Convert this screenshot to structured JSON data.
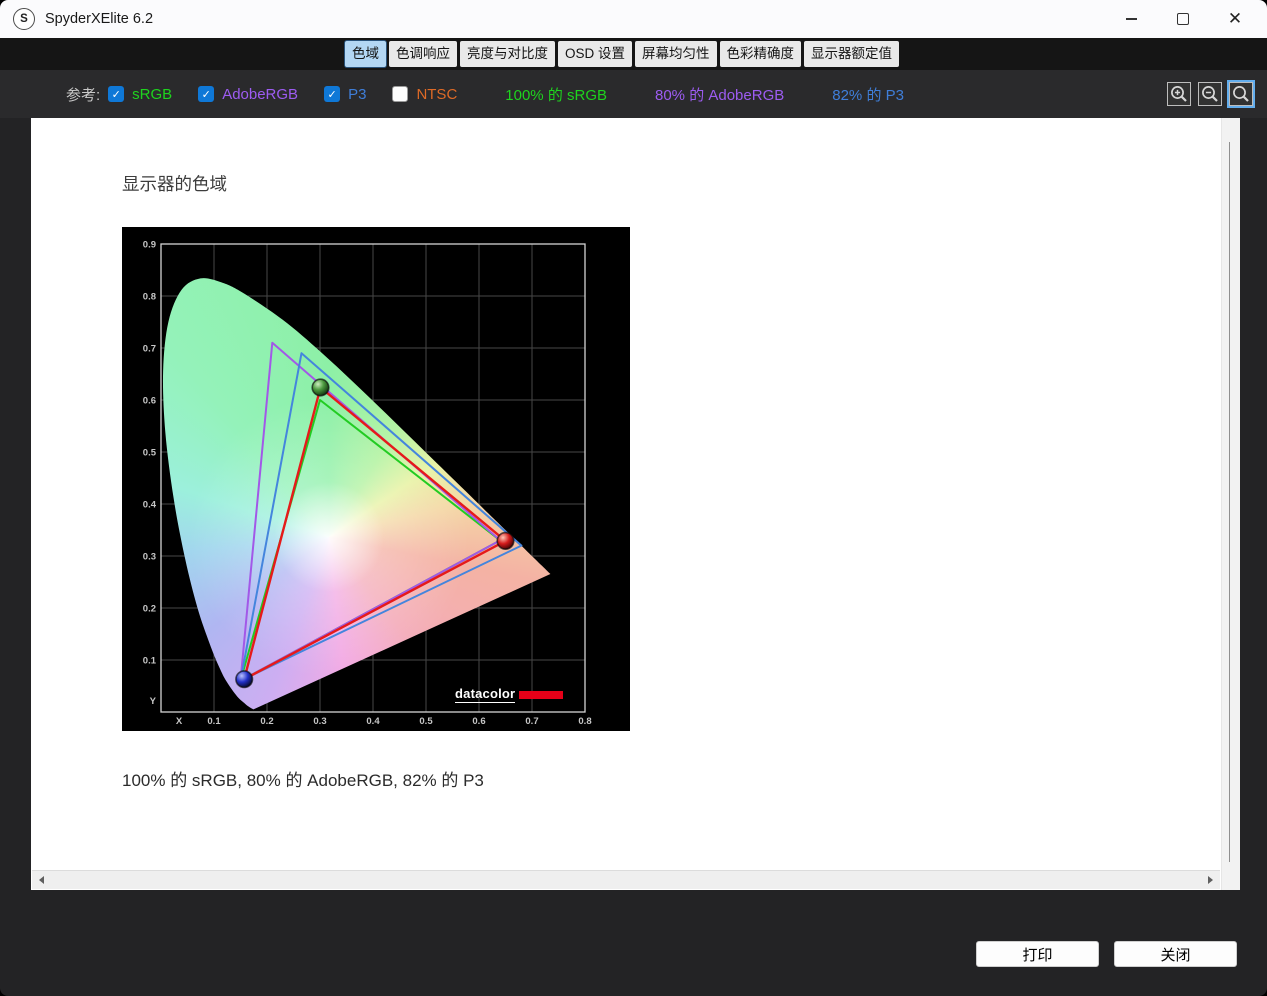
{
  "window": {
    "title": "SpyderXElite 6.2",
    "app_icon_letter": "S"
  },
  "tabs": [
    {
      "label": "色域",
      "selected": true
    },
    {
      "label": "色调响应",
      "selected": false
    },
    {
      "label": "亮度与对比度",
      "selected": false
    },
    {
      "label": "OSD 设置",
      "selected": false
    },
    {
      "label": "屏幕均匀性",
      "selected": false
    },
    {
      "label": "色彩精确度",
      "selected": false
    },
    {
      "label": "显示器额定值",
      "selected": false
    }
  ],
  "reference": {
    "label": "参考:",
    "checkbox_accent": "#0f78d7",
    "checkboxes": [
      {
        "label": "sRGB",
        "checked": true,
        "color": "#1ed31e"
      },
      {
        "label": "AdobeRGB",
        "checked": true,
        "color": "#9d5cf2"
      },
      {
        "label": "P3",
        "checked": true,
        "color": "#3f7ed9"
      },
      {
        "label": "NTSC",
        "checked": false,
        "color": "#df6a26"
      }
    ],
    "results": [
      {
        "text": "100% 的 sRGB",
        "color": "#1ed31e"
      },
      {
        "text": "80% 的 AdobeRGB",
        "color": "#9d5cf2"
      },
      {
        "text": "82% 的 P3",
        "color": "#3f7ed9"
      }
    ]
  },
  "toolbar": {
    "zoom_buttons": [
      {
        "icon": "zoom-in",
        "selected": false
      },
      {
        "icon": "zoom-out",
        "selected": false
      },
      {
        "icon": "zoom-reset",
        "selected": true
      }
    ]
  },
  "page": {
    "heading": "显示器的色域",
    "caption": "100% 的 sRGB, 80% 的 AdobeRGB, 82% 的 P3"
  },
  "buttons": {
    "print": "打印",
    "close": "关闭"
  },
  "chart_data": {
    "type": "scatter",
    "title": "显示器的色域",
    "xlabel": "X",
    "ylabel": "Y",
    "xlim": [
      0,
      0.8
    ],
    "ylim": [
      0,
      0.9
    ],
    "xticks": [
      0.1,
      0.2,
      0.3,
      0.4,
      0.5,
      0.6,
      0.7,
      0.8
    ],
    "yticks": [
      0.1,
      0.2,
      0.3,
      0.4,
      0.5,
      0.6,
      0.7,
      0.8,
      0.9
    ],
    "grid": true,
    "background": "#000000",
    "series": [
      {
        "name": "sRGB",
        "color": "#22cc22",
        "stroke_width": 2,
        "vertices": [
          [
            0.64,
            0.33
          ],
          [
            0.3,
            0.6
          ],
          [
            0.15,
            0.06
          ]
        ]
      },
      {
        "name": "AdobeRGB",
        "color": "#a258e8",
        "stroke_width": 2,
        "vertices": [
          [
            0.64,
            0.33
          ],
          [
            0.21,
            0.71
          ],
          [
            0.15,
            0.06
          ]
        ]
      },
      {
        "name": "P3",
        "color": "#4485dd",
        "stroke_width": 2,
        "vertices": [
          [
            0.68,
            0.32
          ],
          [
            0.265,
            0.69
          ],
          [
            0.15,
            0.06
          ]
        ]
      },
      {
        "name": "display-gamut",
        "color": "#e61a1a",
        "stroke_width": 2.4,
        "vertices": [
          [
            0.65,
            0.329
          ],
          [
            0.301,
            0.624
          ],
          [
            0.157,
            0.063
          ]
        ]
      }
    ],
    "points": [
      {
        "name": "red-primary",
        "x": 0.65,
        "y": 0.329,
        "fill": "red"
      },
      {
        "name": "green-primary",
        "x": 0.301,
        "y": 0.624,
        "fill": "green"
      },
      {
        "name": "blue-primary",
        "x": 0.157,
        "y": 0.063,
        "fill": "blue"
      }
    ],
    "locus": [
      [
        0.1741,
        0.005
      ],
      [
        0.1644,
        0.0109
      ],
      [
        0.1566,
        0.0177
      ],
      [
        0.144,
        0.0297
      ],
      [
        0.1241,
        0.0578
      ],
      [
        0.1096,
        0.0868
      ],
      [
        0.0913,
        0.1327
      ],
      [
        0.0687,
        0.2007
      ],
      [
        0.0454,
        0.295
      ],
      [
        0.0235,
        0.4127
      ],
      [
        0.0082,
        0.5384
      ],
      [
        0.0039,
        0.6548
      ],
      [
        0.0139,
        0.7502
      ],
      [
        0.0389,
        0.812
      ],
      [
        0.0743,
        0.8338
      ],
      [
        0.1142,
        0.8262
      ],
      [
        0.1547,
        0.8059
      ],
      [
        0.2296,
        0.7543
      ],
      [
        0.3016,
        0.6923
      ],
      [
        0.3731,
        0.6245
      ],
      [
        0.4441,
        0.5547
      ],
      [
        0.5125,
        0.4866
      ],
      [
        0.5752,
        0.4242
      ],
      [
        0.627,
        0.3725
      ],
      [
        0.6658,
        0.334
      ],
      [
        0.6915,
        0.3083
      ],
      [
        0.719,
        0.2809
      ],
      [
        0.7347,
        0.2653
      ]
    ],
    "white_point": [
      0.317,
      0.336
    ],
    "watermark": "datacolor"
  }
}
